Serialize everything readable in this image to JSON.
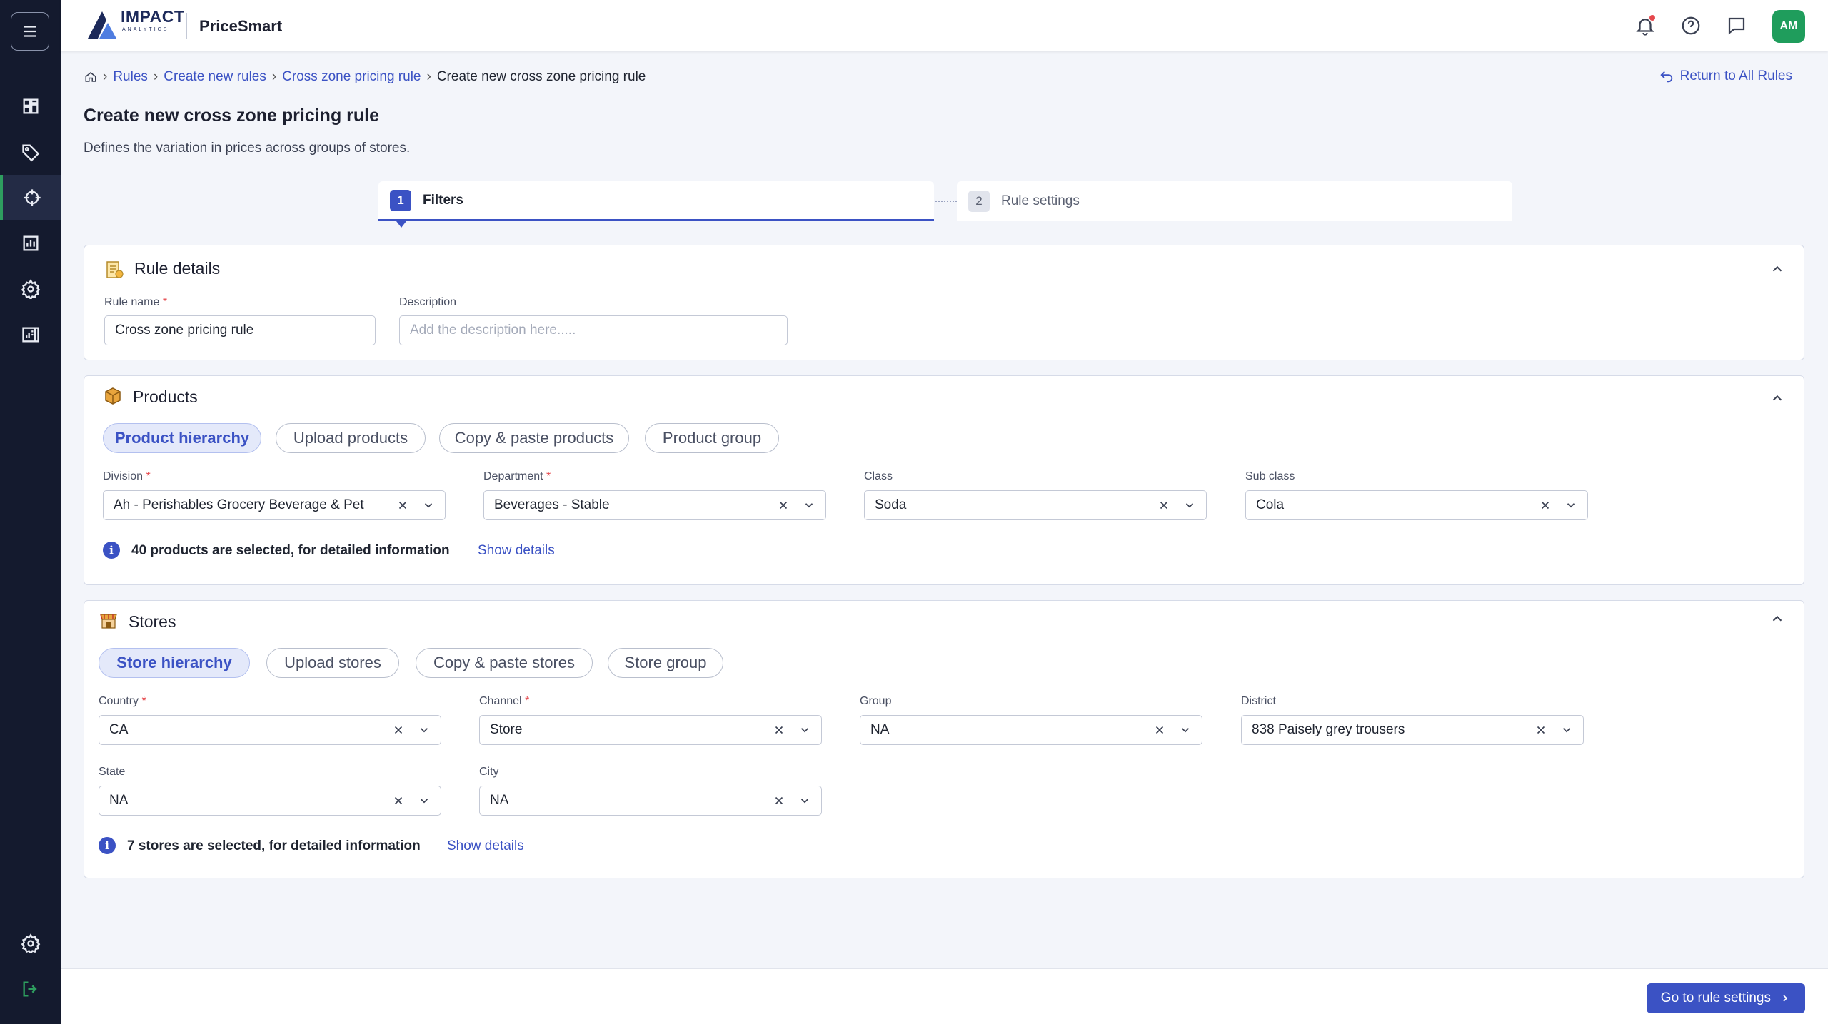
{
  "brand": {
    "logo_text": "IMPACT",
    "logo_sub": "ANALYTICS",
    "app_name": "PriceSmart"
  },
  "user": {
    "initials": "AM"
  },
  "sidebar": {
    "items": [
      {
        "name": "dashboard-icon"
      },
      {
        "name": "tag-icon"
      },
      {
        "name": "crosshair-icon",
        "active": true
      },
      {
        "name": "report-icon"
      },
      {
        "name": "gear-icon"
      },
      {
        "name": "document-chart-icon"
      }
    ],
    "bottom": [
      {
        "name": "settings-icon"
      },
      {
        "name": "logout-icon"
      }
    ]
  },
  "breadcrumb": {
    "items": [
      "Rules",
      "Create new rules",
      "Cross zone pricing rule"
    ],
    "current": "Create new cross zone pricing rule",
    "separator": "›"
  },
  "return_link": "Return to All Rules",
  "page": {
    "title": "Create new cross zone pricing rule",
    "description": "Defines the variation in prices across groups of stores."
  },
  "steps": [
    {
      "num": "1",
      "label": "Filters",
      "active": true
    },
    {
      "num": "2",
      "label": "Rule settings",
      "active": false
    }
  ],
  "rule_details": {
    "title": "Rule details",
    "name_label": "Rule name",
    "name_value": "Cross zone pricing rule",
    "desc_label": "Description",
    "desc_placeholder": "Add the description here....."
  },
  "products": {
    "title": "Products",
    "tabs": [
      "Product hierarchy",
      "Upload products",
      "Copy & paste products",
      "Product group"
    ],
    "active_tab": 0,
    "fields": [
      {
        "label": "Division",
        "required": "*",
        "value": "Ah - Perishables Grocery Beverage & Pet"
      },
      {
        "label": "Department",
        "required": "*",
        "value": "Beverages - Stable"
      },
      {
        "label": "Class",
        "required": "",
        "value": "Soda"
      },
      {
        "label": "Sub class",
        "required": "",
        "value": "Cola"
      }
    ],
    "info": "40 products are selected, for detailed information",
    "info_link": "Show details"
  },
  "stores": {
    "title": "Stores",
    "tabs": [
      "Store hierarchy",
      "Upload stores",
      "Copy & paste stores",
      "Store group"
    ],
    "active_tab": 0,
    "fields": [
      {
        "label": "Country",
        "required": "*",
        "value": "CA"
      },
      {
        "label": "Channel",
        "required": "*",
        "value": "Store"
      },
      {
        "label": "Group",
        "required": "",
        "value": "NA"
      },
      {
        "label": "District",
        "required": "",
        "value": "838 Paisely grey trousers"
      },
      {
        "label": "State",
        "required": "",
        "value": "NA"
      },
      {
        "label": "City",
        "required": "",
        "value": "NA"
      }
    ],
    "info": "7 stores are selected, for detailed information",
    "info_link": "Show details"
  },
  "footer": {
    "next_button": "Go to rule settings"
  },
  "colors": {
    "accent": "#3b52c4",
    "sidebar_bg": "#141a2e",
    "avatar": "#1f9d5c",
    "required": "#e5484d"
  }
}
